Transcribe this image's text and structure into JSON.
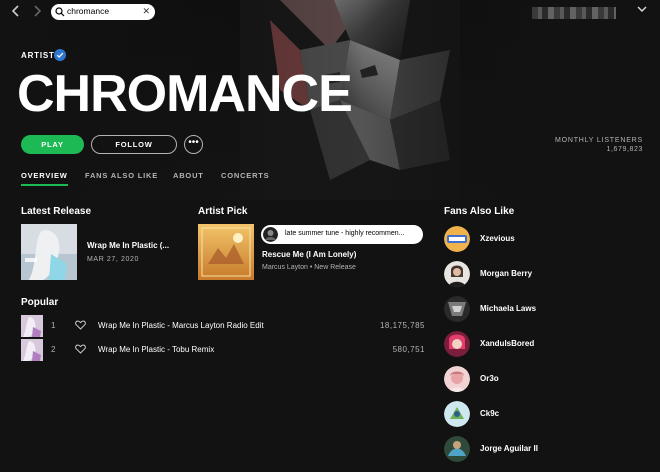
{
  "topbar": {
    "back_icon": "chevron-left-icon",
    "forward_icon": "chevron-right-icon",
    "search_value": "chromance",
    "search_icon": "search-icon",
    "clear_icon": "close-icon",
    "dropdown_icon": "chevron-down-icon"
  },
  "artist": {
    "label": "ARTIST",
    "name": "CHROMANCE",
    "verified": true
  },
  "actions": {
    "play_label": "PLAY",
    "follow_label": "FOLLOW",
    "more_label": "•••"
  },
  "listeners": {
    "label": "MONTHLY LISTENERS",
    "value": "1,679,823"
  },
  "tabs": [
    {
      "label": "OVERVIEW",
      "active": true
    },
    {
      "label": "FANS ALSO LIKE",
      "active": false
    },
    {
      "label": "ABOUT",
      "active": false
    },
    {
      "label": "CONCERTS",
      "active": false
    }
  ],
  "latest_release": {
    "section_title": "Latest Release",
    "title": "Wrap Me In Plastic (...",
    "date": "MAR 27, 2020"
  },
  "artist_pick": {
    "section_title": "Artist Pick",
    "bubble_text": "late summer tune - highly recommen...",
    "title": "Rescue Me (I Am Lonely)",
    "subtitle": "Marcus Layton • New Release"
  },
  "popular": {
    "section_title": "Popular",
    "tracks": [
      {
        "num": "1",
        "title": "Wrap Me In Plastic - Marcus Layton Radio Edit",
        "plays": "18,175,785"
      },
      {
        "num": "2",
        "title": "Wrap Me In Plastic - Tobu Remix",
        "plays": "580,751"
      }
    ]
  },
  "fans_also_like": {
    "section_title": "Fans Also Like",
    "artists": [
      {
        "name": "Xzevious"
      },
      {
        "name": "Morgan Berry"
      },
      {
        "name": "Michaela Laws"
      },
      {
        "name": "XandulsBored"
      },
      {
        "name": "Or3o"
      },
      {
        "name": "Ck9c"
      },
      {
        "name": "Jorge Aguilar II"
      }
    ]
  },
  "colors": {
    "accent": "#1db954",
    "background": "#121212",
    "text_muted": "#b3b3b3"
  }
}
